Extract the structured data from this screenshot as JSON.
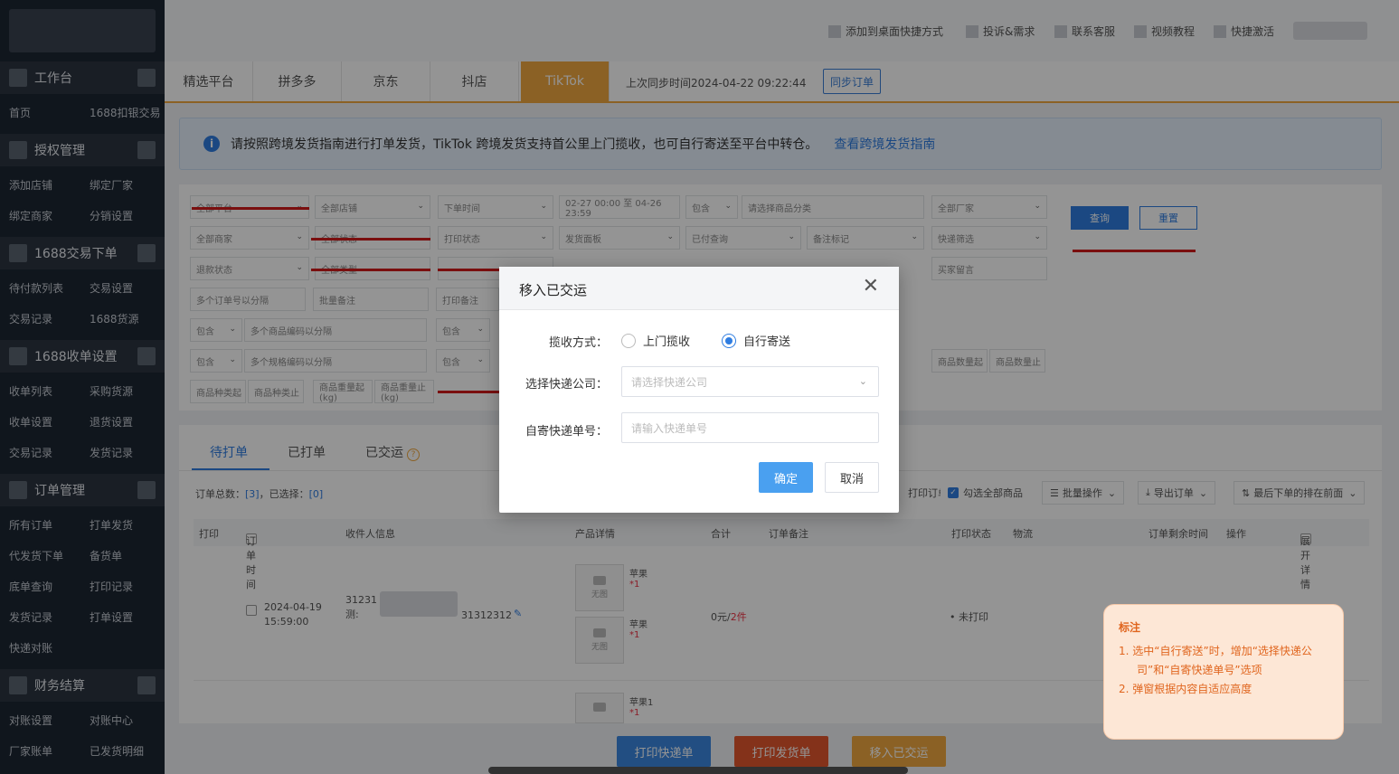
{
  "sidebar": {
    "sections": [
      {
        "title": "工作台",
        "rows": [
          [
            "首页",
            "1688扣银交易"
          ]
        ]
      },
      {
        "title": "授权管理",
        "rows": [
          [
            "添加店铺",
            "绑定厂家"
          ],
          [
            "绑定商家",
            "分销设置"
          ]
        ]
      },
      {
        "title": "1688交易下单",
        "rows": [
          [
            "待付款列表",
            "交易设置"
          ],
          [
            "交易记录",
            "1688货源"
          ]
        ]
      },
      {
        "title": "1688收单设置",
        "rows": [
          [
            "收单列表",
            "采购货源"
          ],
          [
            "收单设置",
            "退货设置"
          ],
          [
            "交易记录",
            "发货记录"
          ]
        ]
      },
      {
        "title": "订单管理",
        "rows": [
          [
            "所有订单",
            "打单发货"
          ],
          [
            "代发货下单",
            "备货单"
          ],
          [
            "底单查询",
            "打印记录"
          ],
          [
            "发货记录",
            "打单设置"
          ],
          [
            "快递对账",
            ""
          ]
        ]
      },
      {
        "title": "财务结算",
        "rows": [
          [
            "对账设置",
            "对账中心"
          ],
          [
            "厂家账单",
            "已发货明细"
          ]
        ]
      }
    ]
  },
  "topbar": {
    "links": [
      "添加到桌面快捷方式",
      "投诉&需求",
      "联系客服",
      "视频教程",
      "快捷激活"
    ]
  },
  "tabs": {
    "items": [
      "精选平台",
      "拼多多",
      "京东",
      "抖店",
      "TikTok"
    ],
    "active_index": 4,
    "sync_time": "上次同步时间2024-04-22 09:22:44",
    "sync_button": "同步订单"
  },
  "notice": {
    "text": "请按照跨境发货指南进行打单发货，TikTok 跨境发货支持首公里上门揽收，也可自行寄送至平台中转仓。",
    "link": "查看跨境发货指南"
  },
  "filters": {
    "row1": [
      "全部平台",
      "全部店铺",
      "下单时间",
      "02-27 00:00 至 04-26 23:59",
      "包含",
      "请选择商品分类",
      "全部厂家"
    ],
    "row2": [
      "全部商家",
      "全部状态",
      "打印状态",
      "发货面板",
      "已付查询",
      "备注标记",
      "快递筛选"
    ],
    "row3": [
      "退款状态",
      "全部类型",
      "",
      "",
      "",
      "",
      "买家留言"
    ],
    "row4": [
      "多个订单号以分隔",
      "批量备注",
      "打印备注"
    ],
    "row5": [
      "包含",
      "多个商品编码以分隔",
      "包含"
    ],
    "row6": [
      "包含",
      "多个规格编码以分隔",
      "包含",
      "商品数量起",
      "商品数量止"
    ],
    "row7": [
      "商品种类起",
      "商品种类止",
      "商品重量起(kg)",
      "商品重量止(kg)"
    ],
    "query_button": "查询",
    "reset_button": "重置"
  },
  "list": {
    "tabs": [
      "待打单",
      "已打单",
      "已交运"
    ],
    "counts_label_total": "订单总数：",
    "counts_total": "[3]",
    "counts_label_selected": "，已选择：",
    "counts_selected": "[0]",
    "tools": [
      "打印订单",
      "勾选全部商品",
      "批量操作",
      "导出订单",
      "最后下单的排在前面"
    ],
    "headers": [
      "打印",
      "订单时间",
      "收件人信息",
      "产品详情",
      "合计",
      "订单备注",
      "打印状态",
      "物流",
      "订单剩余时间",
      "操作",
      "展开详情"
    ],
    "row": {
      "date": "2024-04-19",
      "time": "15:59:00",
      "recipient_a": "31231",
      "recipient_b": "测:",
      "recipient_tail": "31312312",
      "product_name": "苹果",
      "product_qty": "*1",
      "product_name_3": "苹果1",
      "thumb_label": "无图",
      "total": "0元/",
      "total_count": "2件",
      "print_status": "• 未打印"
    }
  },
  "bottom_buttons": [
    "打印快递单",
    "打印发货单",
    "移入已交运"
  ],
  "modal": {
    "title": "移入已交运",
    "label_method": "揽收方式：",
    "option_pickup": "上门揽收",
    "option_self": "自行寄送",
    "selected": "self",
    "label_company": "选择快递公司：",
    "company_placeholder": "请选择快递公司",
    "label_tracking": "自寄快递单号：",
    "tracking_placeholder": "请输入快递单号",
    "ok_button": "确定",
    "cancel_button": "取消"
  },
  "note": {
    "title": "标注",
    "items": [
      "1. 选中“自行寄送”时，增加“选择快递公司”和“自寄快递单号”选项",
      "2. 弹窗根据内容自适应高度"
    ]
  },
  "colors": {
    "accent": "#f0a840",
    "primary": "#2f7de1",
    "sidebar": "#1d2733",
    "print_courier": "#3b87e0",
    "print_invoice": "#e4572e",
    "move_shipped": "#f0a840"
  }
}
